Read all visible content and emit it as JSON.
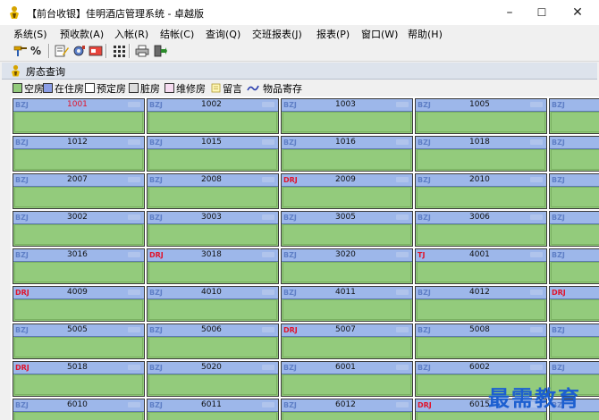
{
  "window": {
    "title": "【前台收银】佳明酒店管理系统 - 卓越版",
    "minimize": "–",
    "maximize": "☐",
    "close": "✕"
  },
  "menu": [
    "系统(S)",
    "预收款(A)",
    "入帐(R)",
    "结帐(C)",
    "查询(Q)",
    "交班报表(J)",
    "报表(P)",
    "窗口(W)",
    "帮助(H)"
  ],
  "toolbar": {
    "buttons": [
      "key-icon",
      "percent-icon",
      "edit-note-icon",
      "settings-icon",
      "card-icon",
      "grid-icon",
      "print-icon",
      "exit-icon"
    ],
    "percent_glyph": "%"
  },
  "panel": {
    "title": "房态查询"
  },
  "legend": [
    {
      "label": "空房",
      "color": "#93cb7c"
    },
    {
      "label": "在住房",
      "color": "#8b9ee6"
    },
    {
      "label": "预定房",
      "color": "#ffffff"
    },
    {
      "label": "脏房",
      "color": "#dcdcdc"
    },
    {
      "label": "维修房",
      "color": "#f6dcf0"
    },
    {
      "label": "留言",
      "icon": "note-icon"
    },
    {
      "label": "物品寄存",
      "icon": "wave-icon"
    }
  ],
  "rooms": [
    [
      "1001",
      "1002",
      "1003",
      "1005",
      ""
    ],
    [
      "1012",
      "1015",
      "1016",
      "1018",
      ""
    ],
    [
      "2007",
      "2008",
      "2009",
      "2010",
      ""
    ],
    [
      "3002",
      "3003",
      "3005",
      "3006",
      ""
    ],
    [
      "3016",
      "3018",
      "3020",
      "4001",
      ""
    ],
    [
      "4009",
      "4010",
      "4011",
      "4012",
      ""
    ],
    [
      "5005",
      "5006",
      "5007",
      "5008",
      ""
    ],
    [
      "5018",
      "5020",
      "6001",
      "6002",
      ""
    ],
    [
      "6010",
      "6011",
      "6012",
      "6015",
      ""
    ]
  ],
  "room_codes": [
    [
      "BZJ",
      "BZJ",
      "BZJ",
      "BZJ",
      "BZJ"
    ],
    [
      "BZJ",
      "BZJ",
      "BZJ",
      "BZJ",
      "BZJ"
    ],
    [
      "BZJ",
      "BZJ",
      "DRJ",
      "BZJ",
      "BZJ"
    ],
    [
      "BZJ",
      "BZJ",
      "BZJ",
      "BZJ",
      "BZJ"
    ],
    [
      "BZJ",
      "DRJ",
      "BZJ",
      "TJ",
      "BZJ"
    ],
    [
      "DRJ",
      "BZJ",
      "BZJ",
      "BZJ",
      "DRJ"
    ],
    [
      "BZJ",
      "BZJ",
      "DRJ",
      "BZJ",
      "BZJ"
    ],
    [
      "DRJ",
      "BZJ",
      "BZJ",
      "BZJ",
      "BZJ"
    ],
    [
      "BZJ",
      "BZJ",
      "BZJ",
      "DRJ",
      "BZJ"
    ]
  ],
  "red_room_numbers": [
    "1001"
  ],
  "watermark": "最需教育"
}
